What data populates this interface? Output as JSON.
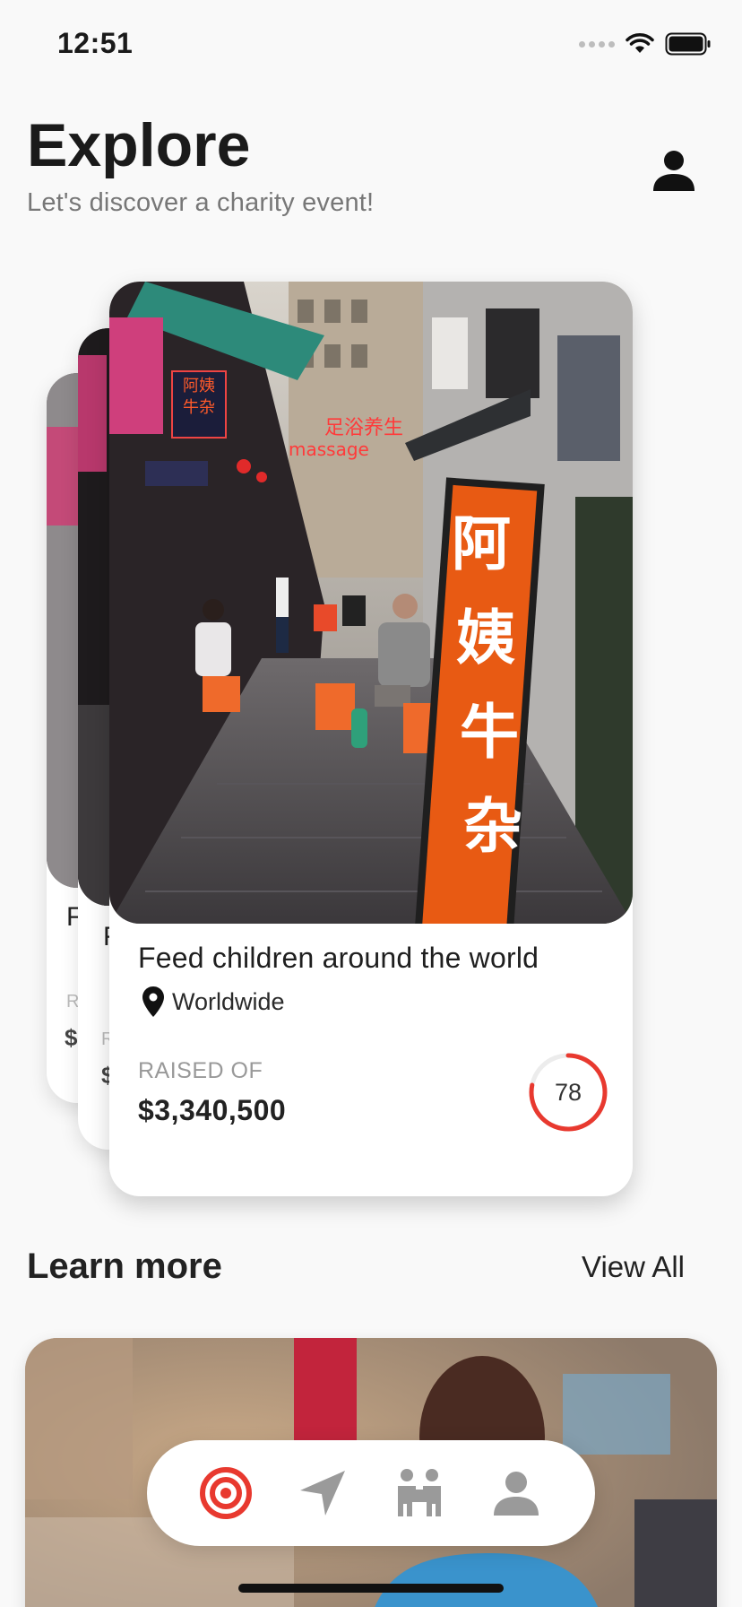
{
  "status_bar": {
    "time": "12:51"
  },
  "header": {
    "title": "Explore",
    "subtitle": "Let's discover a charity event!"
  },
  "back_cards": [
    {
      "title_fragment": "F",
      "raised_fragment": "R",
      "amount_fragment": "$"
    },
    {
      "title_fragment": "F",
      "raised_fragment": "R",
      "amount_fragment": "$"
    }
  ],
  "featured_card": {
    "title": "Feed children around the world",
    "location": "Worldwide",
    "raised_label": "RAISED OF",
    "raised_amount": "$3,340,500",
    "progress_value": "78",
    "progress_percent": 78,
    "photo_sign_text": [
      "阿",
      "姨",
      "牛",
      "杂"
    ],
    "photo_neon_text": "massage"
  },
  "learn_more": {
    "title": "Learn more",
    "view_all_label": "View All"
  },
  "bottom_nav": {
    "items": [
      "target-icon",
      "send-icon",
      "people-icon",
      "person-icon"
    ],
    "active": "target-icon"
  },
  "colors": {
    "accent": "#e8392f",
    "background": "#f9f9f9",
    "inactive_icon": "#9a9a9a",
    "sign_orange": "#e85a13"
  }
}
